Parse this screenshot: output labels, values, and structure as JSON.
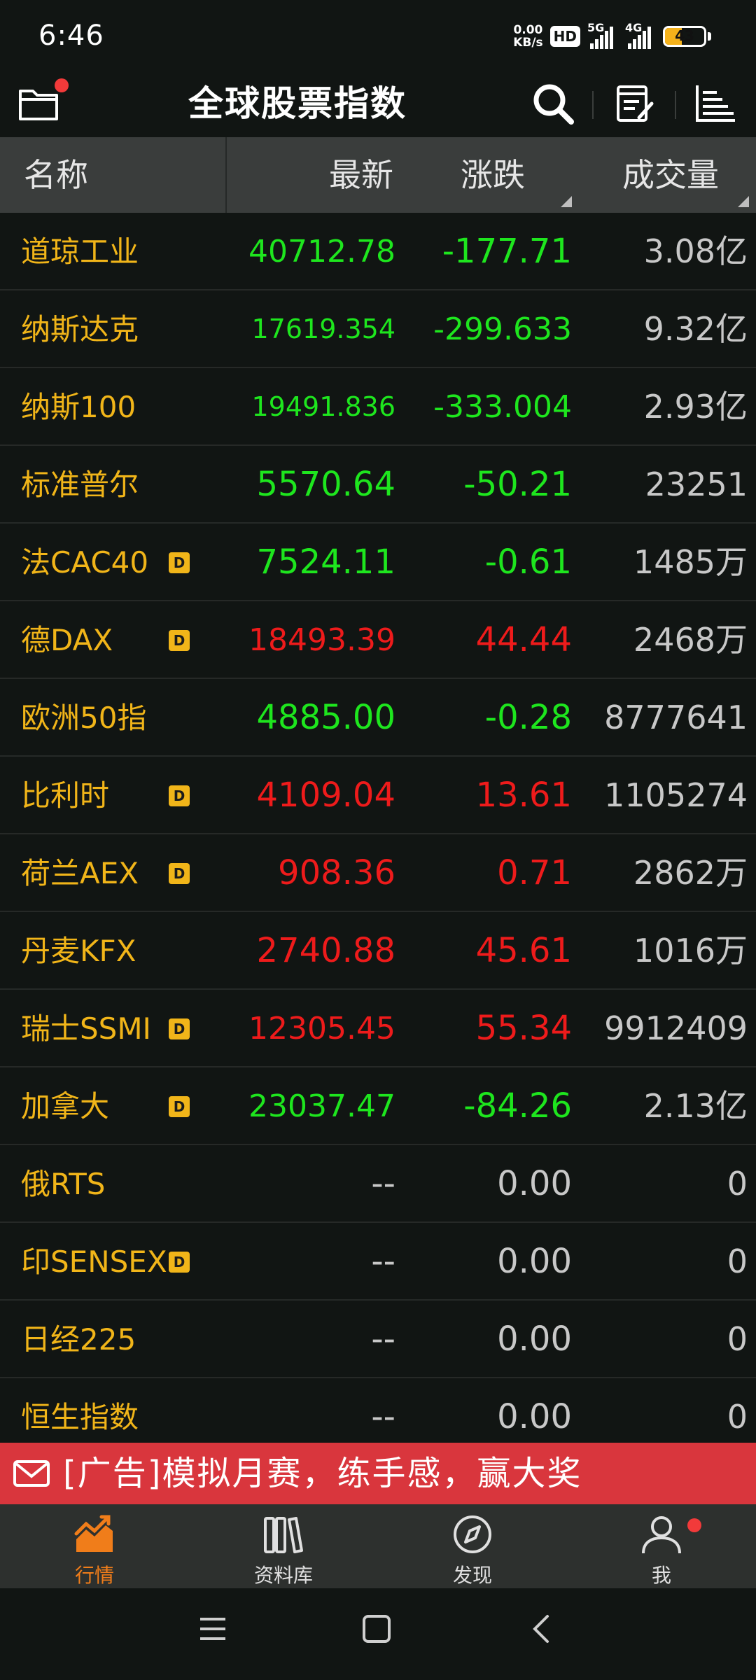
{
  "status_bar": {
    "time": "6:46",
    "net_speed_value": "0.00",
    "net_speed_unit": "KB/s",
    "hd_label": "HD",
    "signal1_label": "5G",
    "signal2_label": "4G",
    "battery_level": "43"
  },
  "header": {
    "title": "全球股票指数"
  },
  "table": {
    "columns": {
      "name": "名称",
      "latest": "最新",
      "change": "涨跌",
      "volume": "成交量"
    },
    "d_badge_label": "D",
    "rows": [
      {
        "name": "道琼工业",
        "badge": false,
        "latest": "40712.78",
        "change": "-177.71",
        "volume": "3.08亿",
        "trend": "down",
        "size": "mid"
      },
      {
        "name": "纳斯达克",
        "badge": false,
        "latest": "17619.354",
        "change": "-299.633",
        "volume": "9.32亿",
        "trend": "down",
        "size": "sm"
      },
      {
        "name": "纳斯100",
        "badge": false,
        "latest": "19491.836",
        "change": "-333.004",
        "volume": "2.93亿",
        "trend": "down",
        "size": "sm"
      },
      {
        "name": "标准普尔",
        "badge": false,
        "latest": "5570.64",
        "change": "-50.21",
        "volume": "23251",
        "trend": "down",
        "size": "big"
      },
      {
        "name": "法CAC40",
        "badge": true,
        "latest": "7524.11",
        "change": "-0.61",
        "volume": "1485万",
        "trend": "down",
        "size": "big"
      },
      {
        "name": "德DAX",
        "badge": true,
        "latest": "18493.39",
        "change": "44.44",
        "volume": "2468万",
        "trend": "up",
        "size": "mid"
      },
      {
        "name": "欧洲50指",
        "badge": false,
        "latest": "4885.00",
        "change": "-0.28",
        "volume": "8777641",
        "trend": "down",
        "size": "big"
      },
      {
        "name": "比利时",
        "badge": true,
        "latest": "4109.04",
        "change": "13.61",
        "volume": "1105274",
        "trend": "up",
        "size": "big"
      },
      {
        "name": "荷兰AEX",
        "badge": true,
        "latest": "908.36",
        "change": "0.71",
        "volume": "2862万",
        "trend": "up",
        "size": "big"
      },
      {
        "name": "丹麦KFX",
        "badge": false,
        "latest": "2740.88",
        "change": "45.61",
        "volume": "1016万",
        "trend": "up",
        "size": "big"
      },
      {
        "name": "瑞士SSMI",
        "badge": true,
        "latest": "12305.45",
        "change": "55.34",
        "volume": "9912409",
        "trend": "up",
        "size": "mid"
      },
      {
        "name": "加拿大",
        "badge": true,
        "latest": "23037.47",
        "change": "-84.26",
        "volume": "2.13亿",
        "trend": "down",
        "size": "mid"
      },
      {
        "name": "俄RTS",
        "badge": false,
        "latest": "--",
        "change": "0.00",
        "volume": "0",
        "trend": "flat",
        "size": "big"
      },
      {
        "name": "印SENSEX",
        "badge": true,
        "latest": "--",
        "change": "0.00",
        "volume": "0",
        "trend": "flat",
        "size": "big"
      },
      {
        "name": "日经225",
        "badge": false,
        "latest": "--",
        "change": "0.00",
        "volume": "0",
        "trend": "flat",
        "size": "big"
      },
      {
        "name": "恒生指数",
        "badge": false,
        "latest": "--",
        "change": "0.00",
        "volume": "0",
        "trend": "flat",
        "size": "big"
      }
    ]
  },
  "ad": {
    "text": "[广告]模拟月赛，练手感，赢大奖"
  },
  "bottom_nav": {
    "items": [
      {
        "label": "行情",
        "icon": "market-chart-icon",
        "active": true
      },
      {
        "label": "资料库",
        "icon": "library-icon",
        "active": false
      },
      {
        "label": "发现",
        "icon": "compass-icon",
        "active": false
      },
      {
        "label": "我",
        "icon": "user-icon",
        "active": false
      }
    ]
  },
  "colors": {
    "background": "#111513",
    "name_yellow": "#f1b519",
    "up_red": "#ee1b1b",
    "down_green": "#1ee61e",
    "flat_gray": "#c8c8c8",
    "ad_red": "#d9363d",
    "nav_active": "#f07d1a"
  }
}
